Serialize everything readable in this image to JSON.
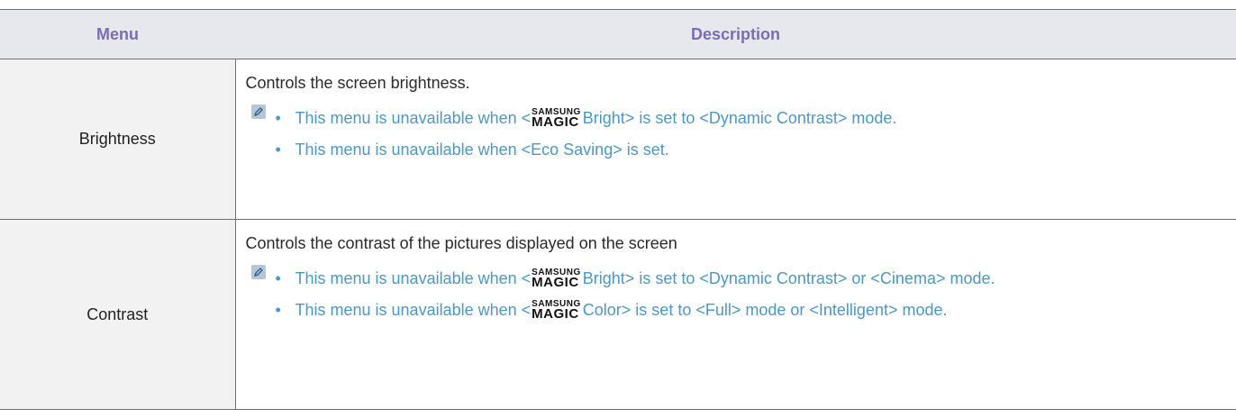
{
  "table": {
    "headers": {
      "menu": "Menu",
      "description": "Description"
    },
    "rows": [
      {
        "menu": "Brightness",
        "description": "Controls the screen brightness.",
        "notes": [
          {
            "prefix": "This menu is unavailable when <",
            "brand_top": "SAMSUNG",
            "brand_bottom": "MAGIC",
            "suffix": "Bright> is set to <Dynamic Contrast> mode."
          },
          {
            "text": "This menu is unavailable when <Eco Saving> is set."
          }
        ]
      },
      {
        "menu": "Contrast",
        "description": "Controls the contrast of the pictures displayed on the screen",
        "notes": [
          {
            "prefix": "This menu is unavailable when <",
            "brand_top": "SAMSUNG",
            "brand_bottom": "MAGIC",
            "suffix": "Bright> is set to <Dynamic Contrast> or <Cinema> mode."
          },
          {
            "prefix": "This menu is unavailable when <",
            "brand_top": "SAMSUNG",
            "brand_bottom": "MAGIC",
            "suffix": "Color> is set to <Full> mode or <Intelligent> mode."
          }
        ]
      }
    ]
  },
  "icons": {
    "note": "note-pencil-icon",
    "bullet": "•"
  },
  "colors": {
    "header_bg": "#e7e7ee",
    "header_text": "#7b6db0",
    "note_text": "#4d97c2",
    "menu_bg": "#f2f2f2"
  }
}
